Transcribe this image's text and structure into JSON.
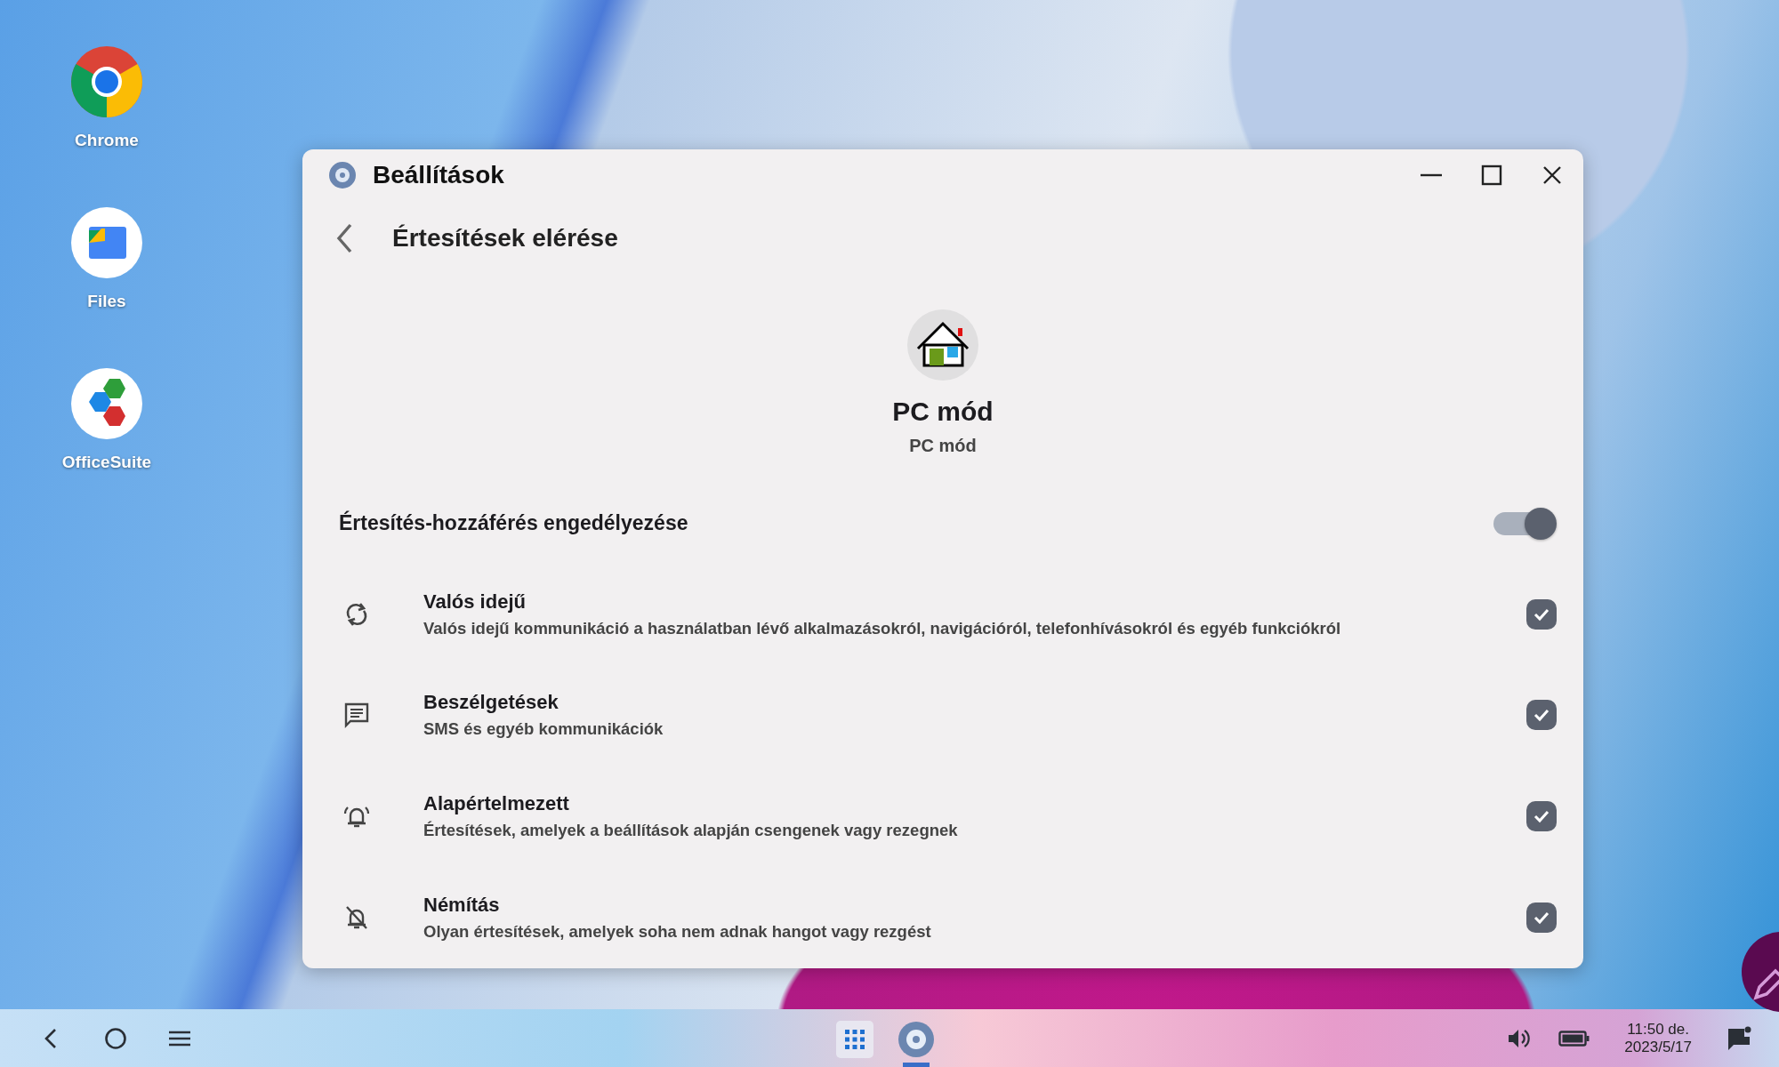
{
  "desktop_icons": [
    {
      "kind": "chrome",
      "label": "Chrome"
    },
    {
      "kind": "files",
      "label": "Files"
    },
    {
      "kind": "office",
      "label": "OfficeSuite"
    }
  ],
  "window": {
    "title": "Beállítások",
    "page_title": "Értesítések elérése",
    "app": {
      "name": "PC mód",
      "subtitle": "PC mód"
    },
    "master_toggle": {
      "label": "Értesítés-hozzáférés engedélyezése",
      "on": true
    },
    "categories": [
      {
        "kind": "realtime",
        "title": "Valós idejű",
        "description": "Valós idejű kommunikáció a használatban lévő alkalmazásokról, navigációról, telefonhívásokról és egyéb funkciókról",
        "checked": true
      },
      {
        "kind": "conversation",
        "title": "Beszélgetések",
        "description": "SMS és egyéb kommunikációk",
        "checked": true
      },
      {
        "kind": "default",
        "title": "Alapértelmezett",
        "description": "Értesítések, amelyek a beállítások alapján csengenek vagy rezegnek",
        "checked": true
      },
      {
        "kind": "silent",
        "title": "Némítás",
        "description": "Olyan értesítések, amelyek soha nem adnak hangot vagy rezgést",
        "checked": true
      }
    ]
  },
  "taskbar": {
    "apps": [
      {
        "kind": "apps",
        "running": false
      },
      {
        "kind": "settings",
        "running": true
      }
    ],
    "time": "11:50 de.",
    "date": "2023/5/17"
  }
}
